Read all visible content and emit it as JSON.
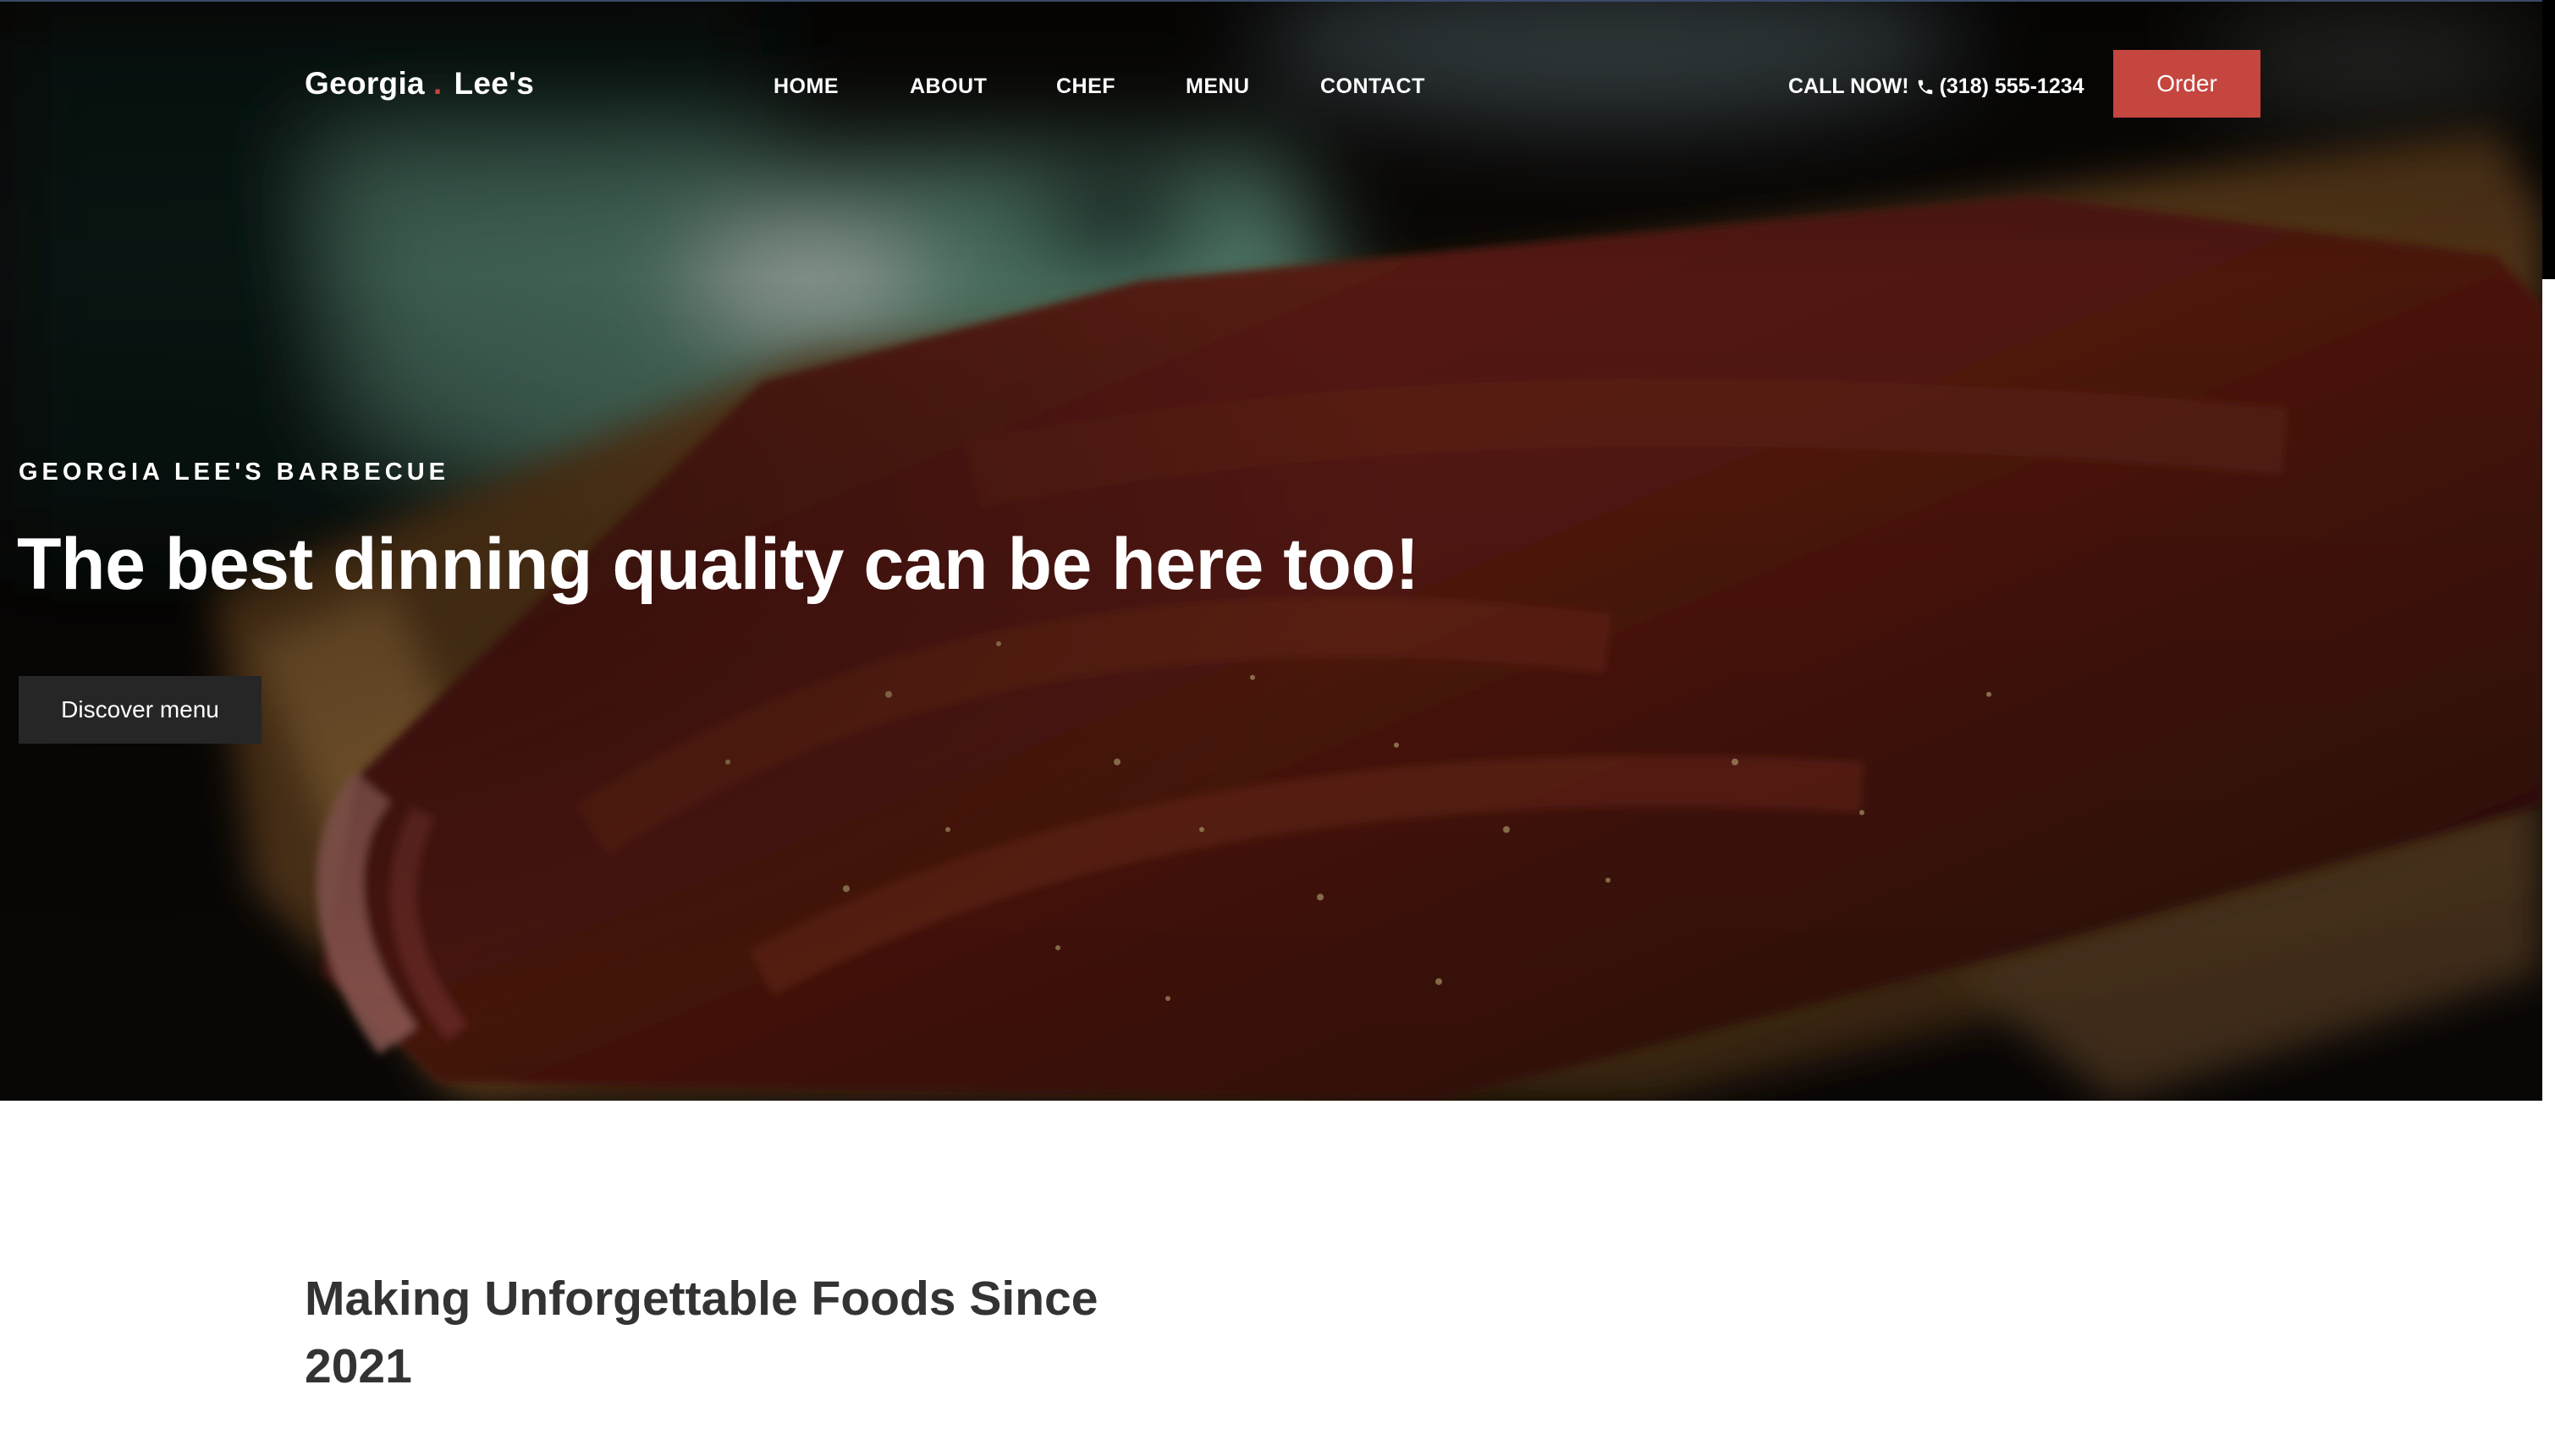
{
  "header": {
    "brand": {
      "name_first": "Georgia",
      "separator": ".",
      "name_last": "Lee's",
      "separator_color": "#c5453f"
    },
    "nav": [
      {
        "label": "HOME"
      },
      {
        "label": "ABOUT"
      },
      {
        "label": "CHEF"
      },
      {
        "label": "MENU"
      },
      {
        "label": "CONTACT"
      }
    ],
    "call": {
      "prefix": "CALL NOW!",
      "icon": "phone-icon",
      "number": "(318) 555-1234"
    },
    "order_button": {
      "label": "Order",
      "color": "#c5453f"
    }
  },
  "hero": {
    "image": "barbecue-ribs-on-cutting-board",
    "eyebrow": "GEORGIA LEE'S BARBECUE",
    "headline": "The best dinning quality can be here too!",
    "cta_button": {
      "label": "Discover menu",
      "color": "#262626"
    }
  },
  "about": {
    "title": "Making Unforgettable Foods Since 2021"
  }
}
